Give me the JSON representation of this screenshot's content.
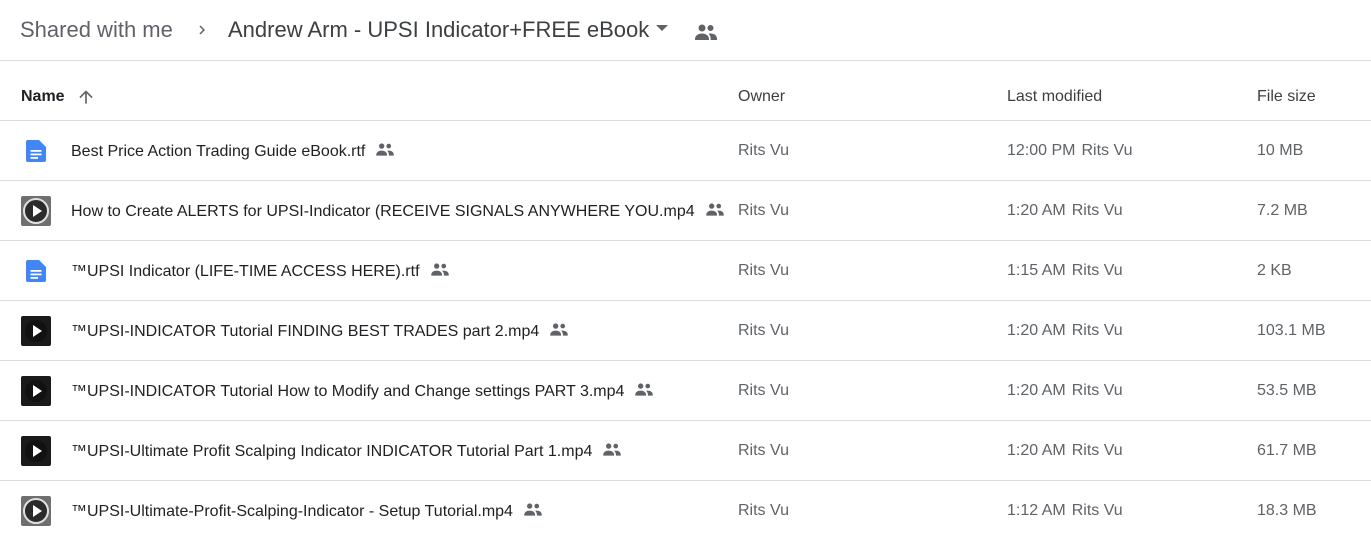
{
  "breadcrumb": {
    "root": "Shared with me",
    "current": "Andrew Arm - UPSI Indicator+FREE eBook",
    "separator_icon": "chevron-right-icon",
    "caret_icon": "arrow-drop-down-icon",
    "shared_icon": "people-icon"
  },
  "columns": {
    "name": "Name",
    "owner": "Owner",
    "modified": "Last modified",
    "size": "File size",
    "sort_icon": "arrow-upward-icon"
  },
  "colors": {
    "doc_blue": "#4285f4",
    "text": "#202124",
    "muted": "#5f6368",
    "divider": "#dadce0"
  },
  "files": [
    {
      "name": "Best Price Action Trading Guide eBook.rtf",
      "type": "doc",
      "owner": "Rits Vu",
      "modified_time": "12:00 PM",
      "modified_by": "Rits Vu",
      "size": "10 MB"
    },
    {
      "name": "How to Create ALERTS for UPSI-Indicator (RECEIVE SIGNALS ANYWHERE YOU.mp4",
      "type": "video",
      "thumb": "grey",
      "owner": "Rits Vu",
      "modified_time": "1:20 AM",
      "modified_by": "Rits Vu",
      "size": "7.2 MB"
    },
    {
      "name": "™UPSI Indicator (LIFE-TIME ACCESS HERE).rtf",
      "type": "doc",
      "owner": "Rits Vu",
      "modified_time": "1:15 AM",
      "modified_by": "Rits Vu",
      "size": "2 KB"
    },
    {
      "name": "™UPSI-INDICATOR Tutorial FINDING BEST TRADES part 2.mp4",
      "type": "video",
      "thumb": "dark",
      "owner": "Rits Vu",
      "modified_time": "1:20 AM",
      "modified_by": "Rits Vu",
      "size": "103.1 MB"
    },
    {
      "name": "™UPSI-INDICATOR Tutorial How to Modify and Change settings PART 3.mp4",
      "type": "video",
      "thumb": "dark",
      "owner": "Rits Vu",
      "modified_time": "1:20 AM",
      "modified_by": "Rits Vu",
      "size": "53.5 MB"
    },
    {
      "name": "™UPSI-Ultimate Profit Scalping Indicator INDICATOR Tutorial Part 1.mp4",
      "type": "video",
      "thumb": "dark",
      "owner": "Rits Vu",
      "modified_time": "1:20 AM",
      "modified_by": "Rits Vu",
      "size": "61.7 MB"
    },
    {
      "name": "™UPSI-Ultimate-Profit-Scalping-Indicator - Setup Tutorial.mp4",
      "type": "video",
      "thumb": "grey",
      "owner": "Rits Vu",
      "modified_time": "1:12 AM",
      "modified_by": "Rits Vu",
      "size": "18.3 MB"
    }
  ]
}
